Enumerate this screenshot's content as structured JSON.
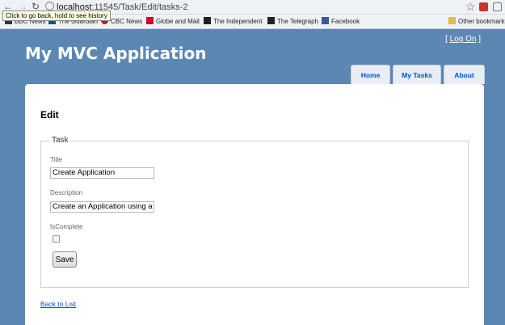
{
  "browser": {
    "address_host": "localhost",
    "address_path": ":11545/Task/Edit/tasks-2",
    "back_tooltip": "Click to go back, hold to see history",
    "bookmarks": [
      {
        "label": "BBC News",
        "icon_color": "#333333"
      },
      {
        "label": "The Guardian",
        "icon_color": "#1d4f91"
      },
      {
        "label": "CBC News",
        "icon_color": "#c8102e"
      },
      {
        "label": "Globe and Mail",
        "icon_color": "#c8102e"
      },
      {
        "label": "The Independent",
        "icon_color": "#222222"
      },
      {
        "label": "The Telegraph",
        "icon_color": "#222222"
      },
      {
        "label": "Facebook",
        "icon_color": "#3b5998"
      },
      {
        "label": "Other bookmarks",
        "icon_color": "#e8b84a"
      }
    ]
  },
  "site": {
    "title": "My MVC Application",
    "login_prefix": "[ ",
    "login_link": "Log On",
    "login_suffix": " ]",
    "menu": [
      "Home",
      "My Tasks",
      "About"
    ]
  },
  "page": {
    "heading": "Edit",
    "legend": "Task",
    "fields": {
      "title_label": "Title",
      "title_value": "Create Application",
      "description_label": "Description",
      "description_value": "Create an Application using a",
      "iscomplete_label": "IsComplete",
      "iscomplete_checked": false
    },
    "save_label": "Save",
    "back_link": "Back to List"
  },
  "colors": {
    "background": "#5c87b2",
    "link": "#034af3",
    "tab_background": "#e8eef4"
  }
}
